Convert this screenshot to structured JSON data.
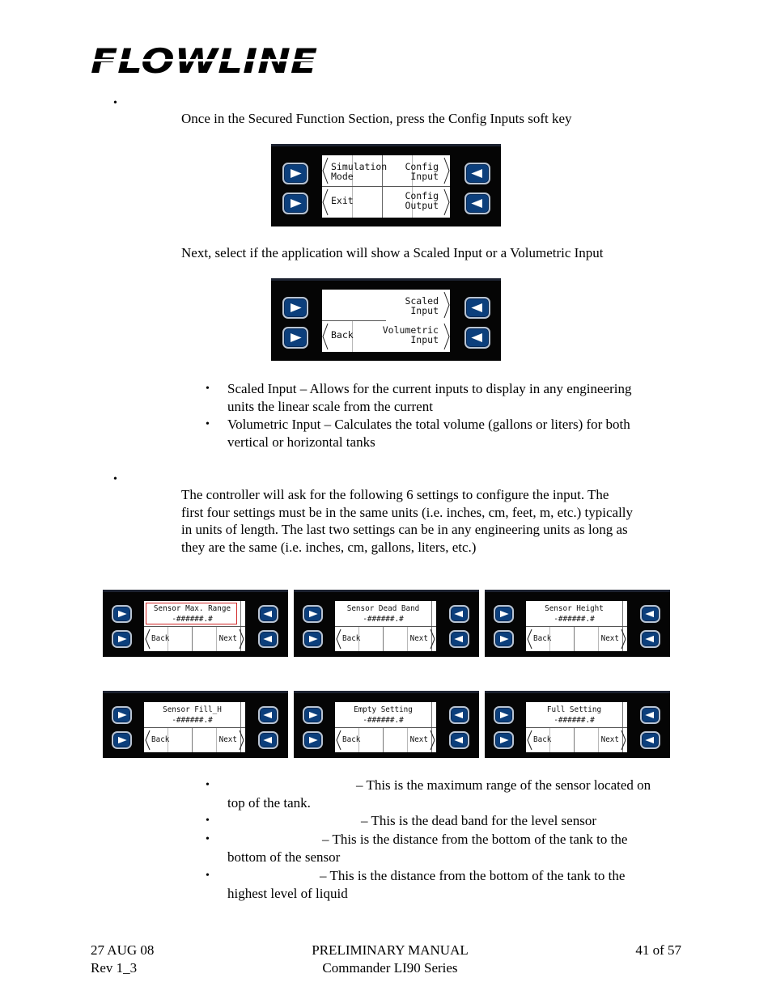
{
  "header": {
    "logo_text": "FLOWLINE"
  },
  "sections": [
    {
      "bullet": "•",
      "intro": "Once in the Secured Function Section, press the Config Inputs soft key",
      "panel": {
        "left_top": [
          "Simulation",
          "Mode"
        ],
        "right_top": [
          "Config",
          "Input"
        ],
        "left_bottom": [
          "Exit"
        ],
        "right_bottom": [
          "Config",
          "Output"
        ]
      }
    },
    {
      "intro": "Next, select if the application will show a Scaled Input or a Volumetric Input",
      "panel": {
        "left_top": [],
        "right_top": [
          "Scaled",
          "Input"
        ],
        "left_bottom": [
          "Back"
        ],
        "right_bottom": [
          "Volumetric",
          "Input"
        ]
      },
      "sub_bullets": [
        {
          "line1": "Scaled Input – Allows for the current inputs to display in any engineering",
          "line2": "units the linear scale from the current"
        },
        {
          "line1": "Volumetric Input – Calculates the total volume (gallons or liters) for both",
          "line2": "vertical or horizontal tanks"
        }
      ]
    },
    {
      "bullet": "•",
      "paragraph": [
        "The controller will ask for the following 6 settings to configure the input.  The",
        "first four settings must be in the same units (i.e. inches, cm, feet, m, etc.) typically",
        "in units of length.  The last two settings can be in any engineering units as long as",
        "they are the same (i.e. inches, cm, gallons, liters, etc.)"
      ]
    }
  ],
  "setting_panels": [
    {
      "title": "Sensor Max. Range",
      "value": "-######.#",
      "back": "Back",
      "next": "Next",
      "selected": true
    },
    {
      "title": "Sensor Dead Band",
      "value": "-######.#",
      "back": "Back",
      "next": "Next",
      "selected": false
    },
    {
      "title": "Sensor Height",
      "value": "-######.#",
      "back": "Back",
      "next": "Next",
      "selected": false
    },
    {
      "title": "Sensor Fill_H",
      "value": "-######.#",
      "back": "Back",
      "next": "Next",
      "selected": false
    },
    {
      "title": "Empty Setting",
      "value": "-######.#",
      "back": "Back",
      "next": "Next",
      "selected": false
    },
    {
      "title": "Full Setting",
      "value": "-######.#",
      "back": "Back",
      "next": "Next",
      "selected": false
    }
  ],
  "descriptions": [
    {
      "line1": "– This is the maximum range of the sensor located on",
      "line2": "top of the tank."
    },
    {
      "line1": "– This is the dead band for the level sensor",
      "line2": ""
    },
    {
      "line1": "– This is the distance from the bottom of the tank to the",
      "line2": "bottom of the sensor"
    },
    {
      "line1": "– This is the distance from the bottom of the tank to the",
      "line2": "highest level of liquid"
    }
  ],
  "footer": {
    "date": "27 AUG 08",
    "rev": "Rev 1_3",
    "title": "PRELIMINARY MANUAL",
    "series": "Commander LI90 Series",
    "page": "41 of 57"
  },
  "colors": {
    "key_blue": "#0c3f7c",
    "selection_red": "#d22b2b"
  }
}
